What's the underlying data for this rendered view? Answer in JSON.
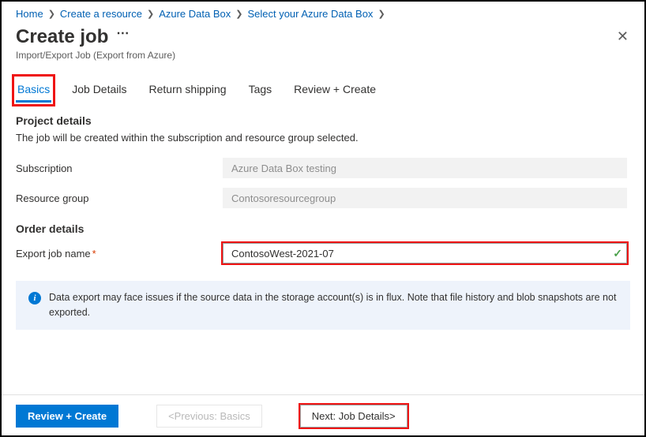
{
  "breadcrumb": {
    "items": [
      "Home",
      "Create a resource",
      "Azure Data Box",
      "Select your Azure Data Box"
    ]
  },
  "header": {
    "title": "Create job",
    "subtitle": "Import/Export Job (Export from Azure)"
  },
  "tabs": {
    "items": [
      {
        "label": "Basics",
        "active": true
      },
      {
        "label": "Job Details",
        "active": false
      },
      {
        "label": "Return shipping",
        "active": false
      },
      {
        "label": "Tags",
        "active": false
      },
      {
        "label": "Review + Create",
        "active": false
      }
    ]
  },
  "project_details": {
    "heading": "Project details",
    "desc": "The job will be created within the subscription and resource group selected.",
    "subscription": {
      "label": "Subscription",
      "value": "Azure Data Box testing"
    },
    "resource_group": {
      "label": "Resource group",
      "value": "Contosoresourcegroup"
    }
  },
  "order_details": {
    "heading": "Order details",
    "job_name": {
      "label": "Export job name",
      "value": "ContosoWest-2021-07",
      "valid": true
    }
  },
  "info": {
    "text": "Data export may face issues if the source data in the storage account(s) is in flux. Note that file history and blob snapshots are not exported."
  },
  "footer": {
    "review": "Review + Create",
    "prev": "<Previous: Basics",
    "next": "Next: Job Details>"
  }
}
